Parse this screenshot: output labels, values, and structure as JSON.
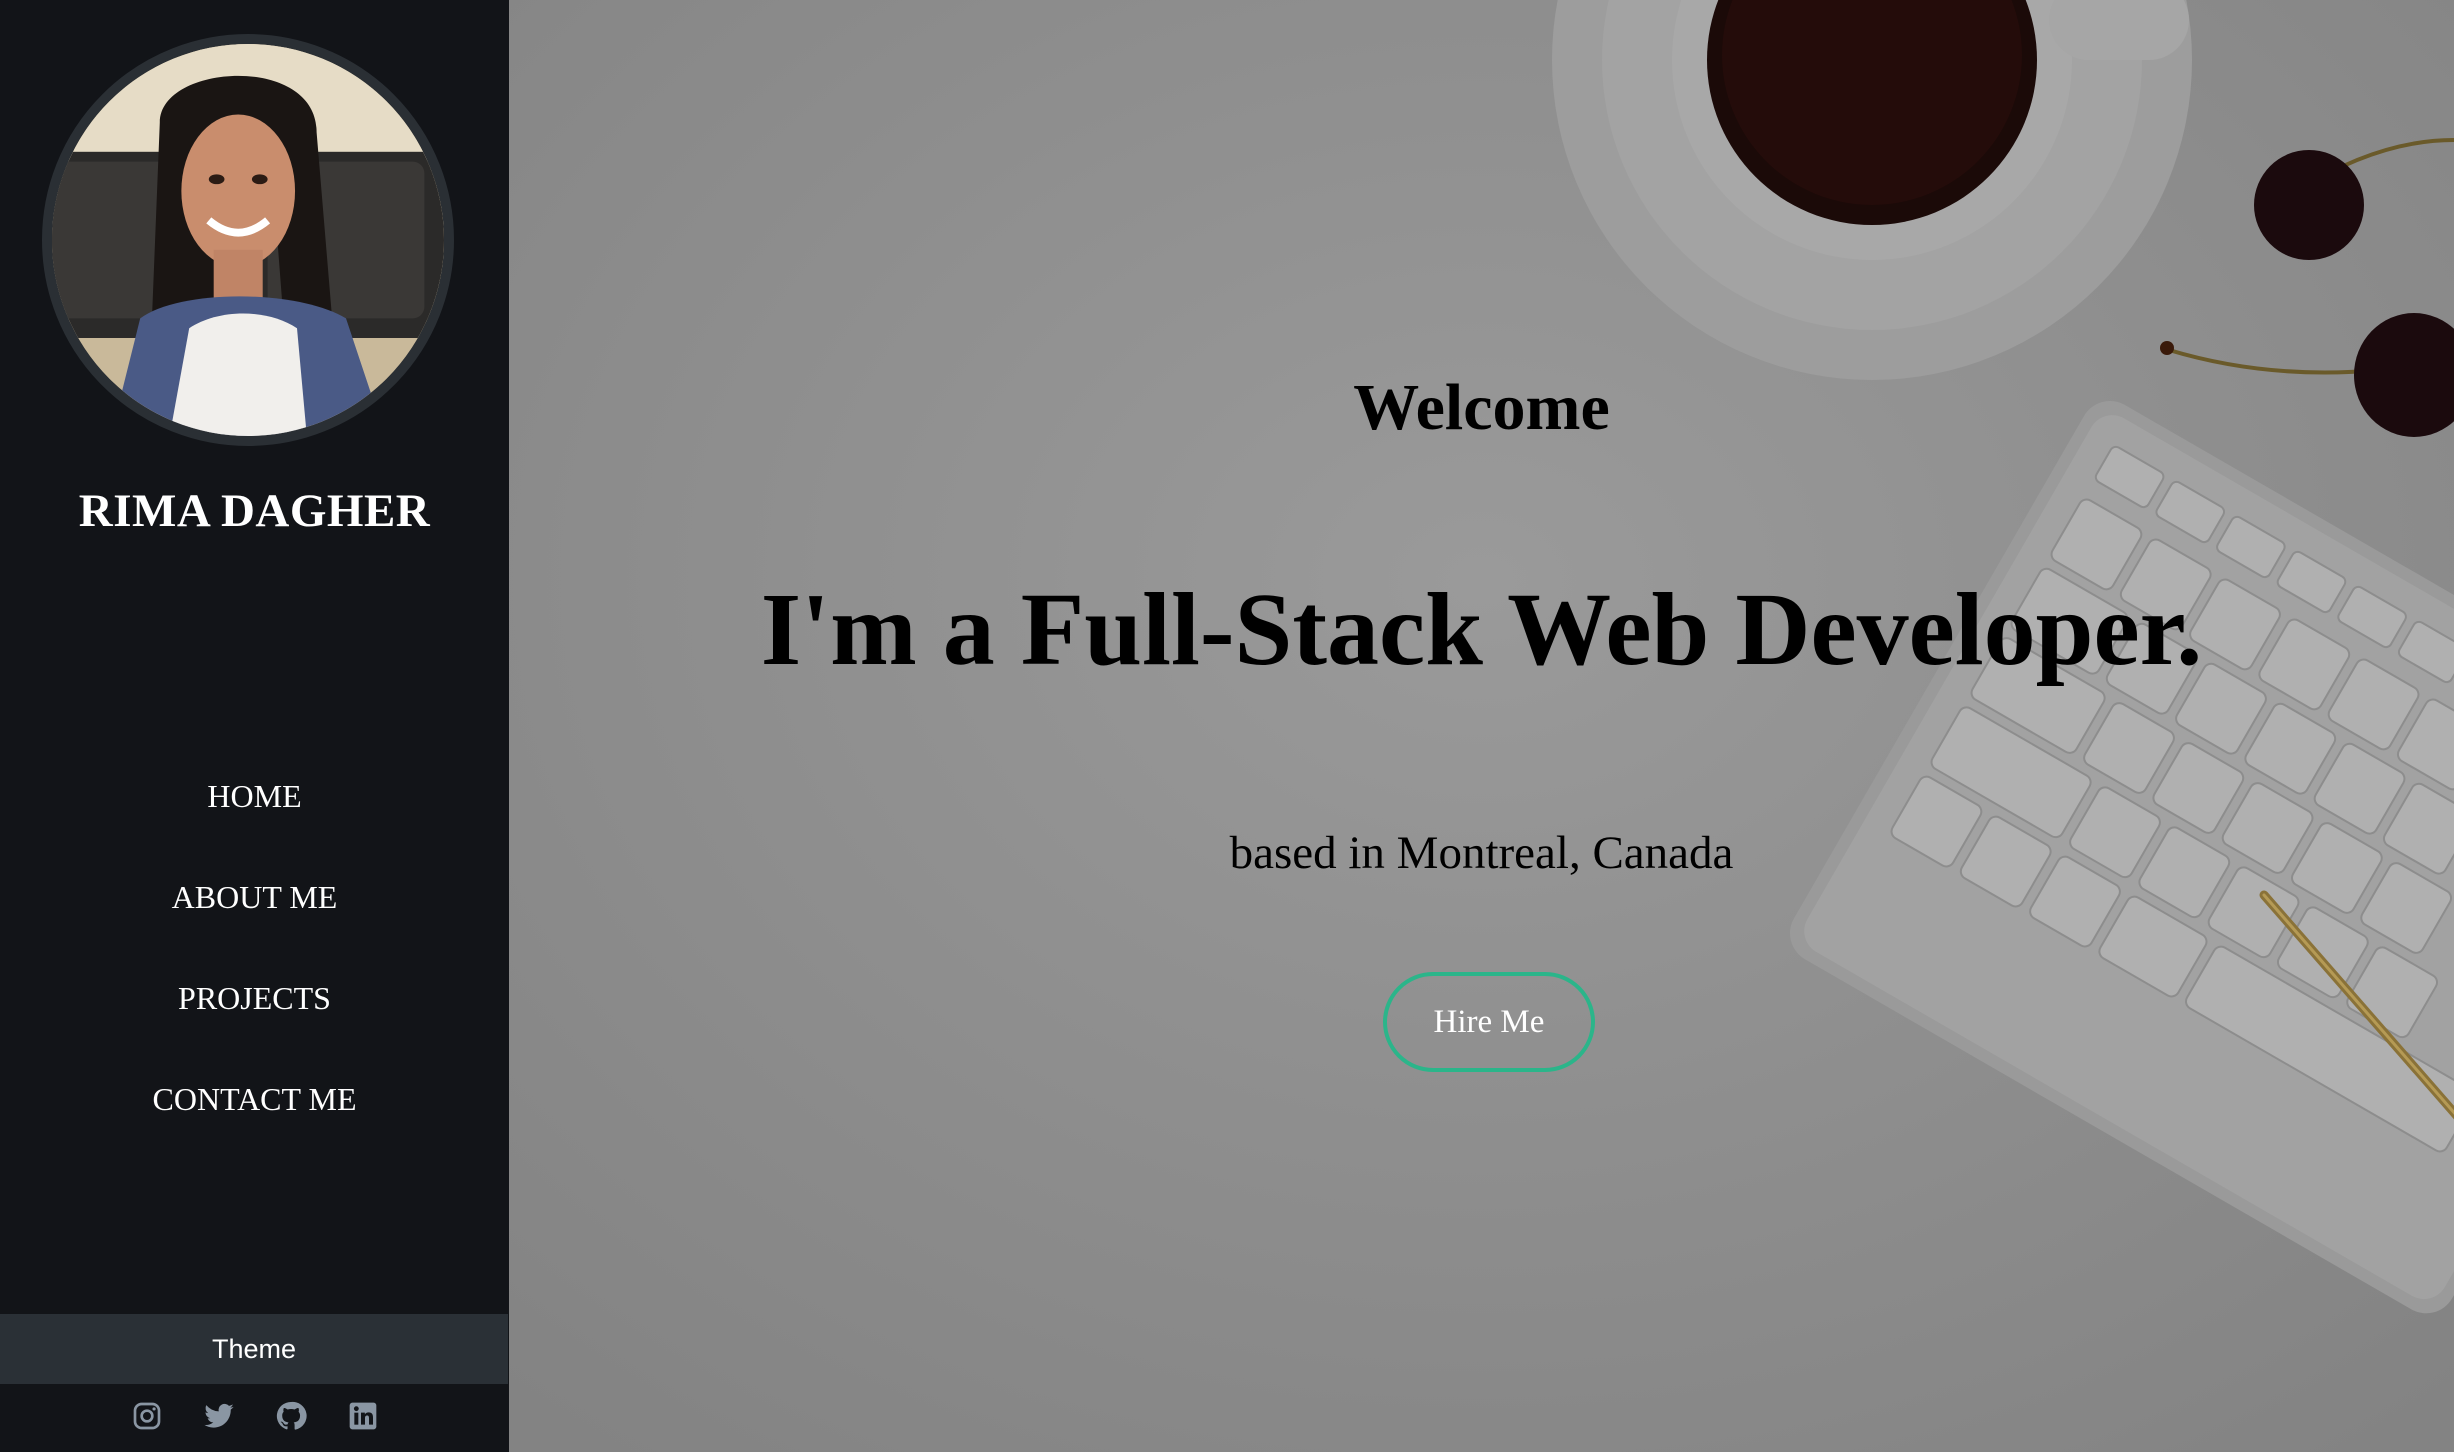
{
  "sidebar": {
    "profile_name": "RIMA DAGHER",
    "nav": [
      {
        "label": "HOME"
      },
      {
        "label": "ABOUT ME"
      },
      {
        "label": "PROJECTS"
      },
      {
        "label": "CONTACT ME"
      }
    ],
    "theme_label": "Theme",
    "socials": [
      {
        "icon": "instagram-icon"
      },
      {
        "icon": "twitter-icon"
      },
      {
        "icon": "github-icon"
      },
      {
        "icon": "linkedin-icon"
      }
    ]
  },
  "hero": {
    "welcome": "Welcome",
    "headline": "I'm a Full-Stack Web Developer.",
    "location": "based in Montreal, Canada",
    "cta_label": "Hire Me"
  },
  "colors": {
    "sidebar_bg": "#121418",
    "theme_bar_bg": "#2a3036",
    "accent": "#2bb58a",
    "social_icon": "#8a96a3"
  }
}
